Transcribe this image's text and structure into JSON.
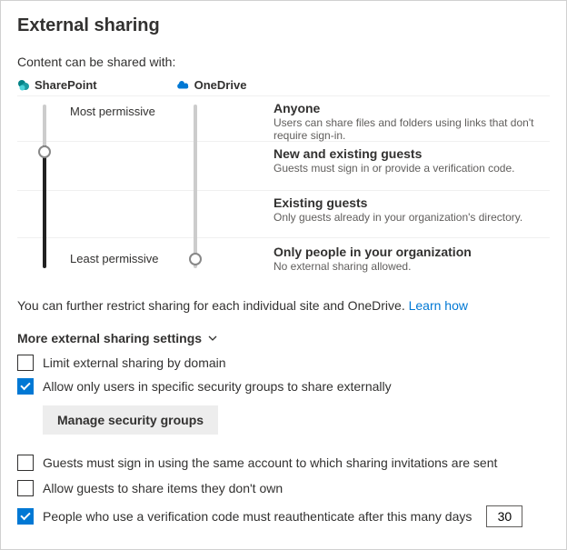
{
  "title": "External sharing",
  "subheading": "Content can be shared with:",
  "products": {
    "sharepoint": "SharePoint",
    "onedrive": "OneDrive"
  },
  "permLabels": {
    "most": "Most permissive",
    "least": "Least permissive"
  },
  "levels": [
    {
      "title": "Anyone",
      "desc": "Users can share files and folders using links that don't require sign-in."
    },
    {
      "title": "New and existing guests",
      "desc": "Guests must sign in or provide a verification code."
    },
    {
      "title": "Existing guests",
      "desc": "Only guests already in your organization's directory."
    },
    {
      "title": "Only people in your organization",
      "desc": "No external sharing allowed."
    }
  ],
  "restrictNote": "You can further restrict sharing for each individual site and OneDrive. ",
  "learnHow": "Learn how",
  "moreSettings": "More external sharing settings",
  "options": {
    "limitDomain": "Limit external sharing by domain",
    "allowGroups": "Allow only users in specific security groups to share externally",
    "manageGroups": "Manage security groups",
    "guestsSameAccount": "Guests must sign in using the same account to which sharing invitations are sent",
    "guestsShareNotOwn": "Allow guests to share items they don't own",
    "reauthDays": "People who use a verification code must reauthenticate after this many days"
  },
  "daysValue": "30"
}
